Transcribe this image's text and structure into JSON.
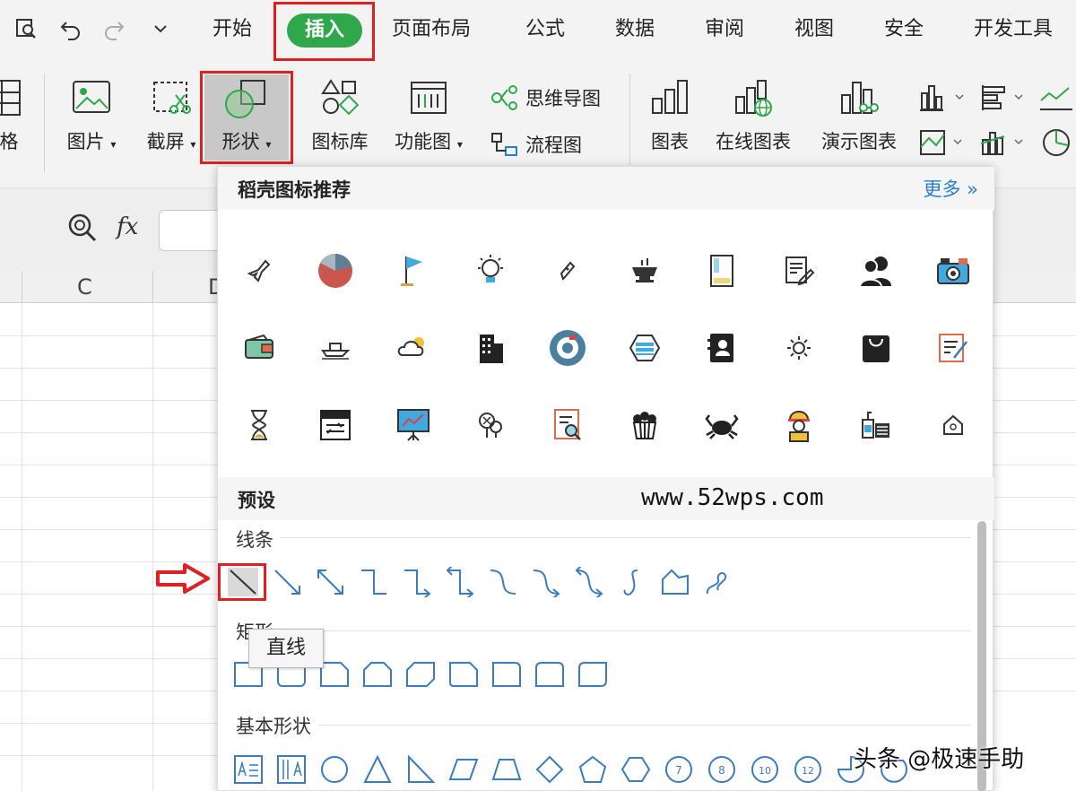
{
  "menu": {
    "tabs": [
      "开始",
      "插入",
      "页面布局",
      "公式",
      "数据",
      "审阅",
      "视图",
      "安全",
      "开发工具"
    ],
    "active_tab": "插入"
  },
  "ribbon": {
    "items": {
      "table_partial": "格",
      "picture": "图片",
      "screenshot": "截屏",
      "shape": "形状",
      "icon_library": "图标库",
      "function_chart": "功能图",
      "mind_map": "思维导图",
      "flowchart": "流程图",
      "chart": "图表",
      "online_chart": "在线图表",
      "presentation_chart": "演示图表"
    }
  },
  "formula_bar": {
    "fx_label": "fx"
  },
  "sheet": {
    "columns": [
      "C",
      "D"
    ]
  },
  "panel": {
    "title": "稻壳图标推荐",
    "more": "更多 »",
    "preset_title": "预设",
    "sections": {
      "lines": "线条",
      "rectangles": "矩形",
      "basic_shapes": "基本形状"
    },
    "tooltip": "直线",
    "number_shapes": [
      "7",
      "8",
      "10",
      "12"
    ]
  },
  "watermark": "www.52wps.com",
  "credit": "头条 @极速手助",
  "colors": {
    "accent_green": "#2ea84a",
    "highlight_red": "#e02020",
    "link_blue": "#2b7cd3",
    "shape_blue": "#3a7cc0"
  }
}
